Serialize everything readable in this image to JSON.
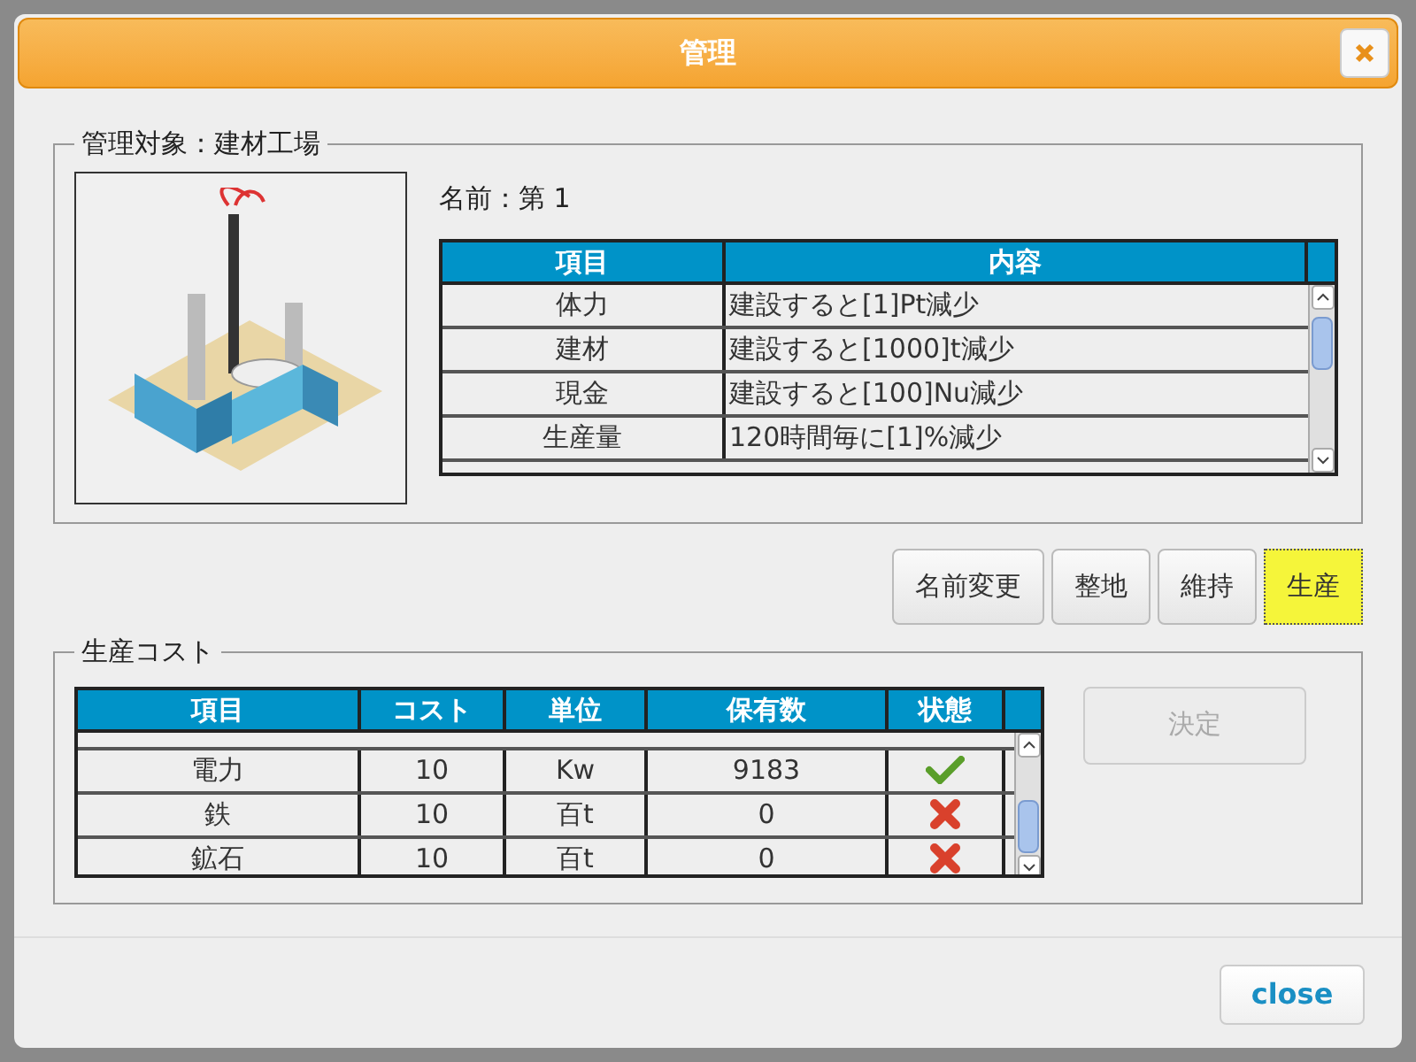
{
  "window": {
    "title": "管理"
  },
  "target": {
    "legend": "管理対象：建材工場",
    "name_label": "名前：第 1",
    "table": {
      "columns": [
        "項目",
        "内容"
      ],
      "rows": [
        {
          "item": "体力",
          "content": "建設すると[1]Pt減少"
        },
        {
          "item": "建材",
          "content": "建設すると[1000]t減少"
        },
        {
          "item": "現金",
          "content": "建設すると[100]Nu減少"
        },
        {
          "item": "生産量",
          "content": "120時間毎に[1]%減少"
        }
      ]
    }
  },
  "actions": [
    {
      "label": "名前変更",
      "selected": false
    },
    {
      "label": "整地",
      "selected": false
    },
    {
      "label": "維持",
      "selected": false
    },
    {
      "label": "生産",
      "selected": true
    }
  ],
  "production": {
    "legend": "生産コスト",
    "table": {
      "columns": [
        "項目",
        "コスト",
        "単位",
        "保有数",
        "状態"
      ],
      "rows": [
        {
          "item": "電力",
          "cost": "10",
          "unit": "Kw",
          "stock": "9183",
          "ok": true
        },
        {
          "item": "鉄",
          "cost": "10",
          "unit": "百t",
          "stock": "0",
          "ok": false
        },
        {
          "item": "鉱石",
          "cost": "10",
          "unit": "百t",
          "stock": "0",
          "ok": false
        }
      ]
    },
    "confirm": {
      "label": "決定",
      "disabled": true
    }
  },
  "close_button": "close"
}
